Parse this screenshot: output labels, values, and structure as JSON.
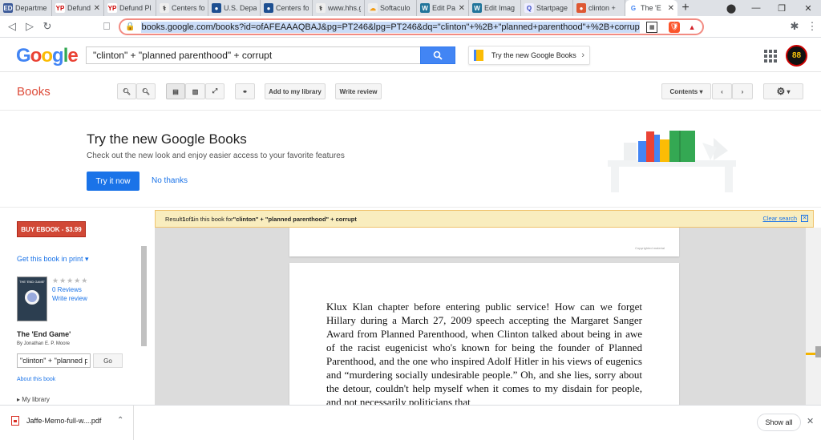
{
  "tabs": [
    {
      "title": "Departme",
      "fav": "ED",
      "favbg": "#3c5a99",
      "favfg": "#fff",
      "close": ""
    },
    {
      "title": "Defund Pl",
      "fav": "YP",
      "favbg": "#fff",
      "favfg": "#c00",
      "close": "✕"
    },
    {
      "title": "Defund Pl",
      "fav": "YP",
      "favbg": "#fff",
      "favfg": "#c00",
      "close": ""
    },
    {
      "title": "Centers fo",
      "fav": "⚕",
      "favbg": "#eee",
      "favfg": "#333",
      "close": ""
    },
    {
      "title": "U.S. Depar",
      "fav": "●",
      "favbg": "#1d4f91",
      "favfg": "#fff",
      "close": ""
    },
    {
      "title": "Centers fo",
      "fav": "●",
      "favbg": "#1d4f91",
      "favfg": "#fff",
      "close": ""
    },
    {
      "title": "www.hhs.g",
      "fav": "⚕",
      "favbg": "#eee",
      "favfg": "#333",
      "close": ""
    },
    {
      "title": "Softaculo",
      "fav": "☁",
      "favbg": "#eee",
      "favfg": "#f39c12",
      "close": ""
    },
    {
      "title": "Edit Pa",
      "fav": "W",
      "favbg": "#21759b",
      "favfg": "#fff",
      "close": "✕"
    },
    {
      "title": "Edit Imag",
      "fav": "W",
      "favbg": "#21759b",
      "favfg": "#fff",
      "close": ""
    },
    {
      "title": "Startpage",
      "fav": "Q",
      "favbg": "#eef",
      "favfg": "#2a3ebf",
      "close": ""
    },
    {
      "title": "clinton +",
      "fav": "●",
      "favbg": "#de5833",
      "favfg": "#fff",
      "close": ""
    },
    {
      "title": "The 'E",
      "fav": "G",
      "favbg": "#fff",
      "favfg": "#4285f4",
      "close": "✕",
      "active": true
    }
  ],
  "toolbar": {
    "url": "books.google.com/books?id=ofAFEAAAQBAJ&pg=PT246&lpg=PT246&dq=\"clinton\"+%2B+\"planned+parenthood\"+%2B+corrupt&source=bl&"
  },
  "google": {
    "logo": [
      "G",
      "o",
      "o",
      "g",
      "l",
      "e"
    ],
    "query": "\"clinton\" + \"planned parenthood\" + corrupt",
    "try_new": "Try the new Google Books",
    "avatar_text": "88"
  },
  "books_bar": {
    "title": "Books",
    "add_library": "Add to my library",
    "write_review": "Write review",
    "contents": "Contents"
  },
  "promo": {
    "heading": "Try the new Google Books",
    "subtext": "Check out the new look and enjoy easier access to your favorite features",
    "try_now": "Try it now",
    "no_thanks": "No thanks",
    "colors": {
      "blue": "#4285f4",
      "red": "#ea4335",
      "yellow": "#fbbc05",
      "green": "#34a853"
    }
  },
  "sidebar": {
    "buy": "BUY EBOOK - $3.99",
    "get_print": "Get this book in print ▾",
    "cover_title": "THE 'END GAME'",
    "stars": "★★★★★",
    "reviews": "0 Reviews",
    "write_review": "Write review",
    "book_title": "The 'End Game'",
    "byline": "By Jonathan E. P. Moore",
    "search_value": "\"clinton\" + \"planned p",
    "go": "Go",
    "about": "About this book",
    "my_library": "▸ My library"
  },
  "result": {
    "prefix": "Result ",
    "n": "1",
    "of": " of ",
    "total": "1",
    "middle": " in this book for ",
    "query": "\"clinton\" + \"planned parenthood\" + corrupt",
    "clear": "Clear search",
    "clear_x": "✕"
  },
  "viewer": {
    "copyright": "Copyrighted material",
    "text": "Klux Klan chapter before entering public service! How can we forget Hillary during a March 27, 2009 speech accepting the Margaret Sanger Award from Planned Parenthood, when Clinton talked about being in awe of the racist eugenicist who's known for being the founder of Planned Parenthood, and the one who inspired Adolf Hitler in his views of eugenics and “murdering socially undesirable people.” Oh, and she lies, sorry about the detour, couldn't help myself when it comes to my disdain for people, and not necessarily politicians that"
  },
  "download": {
    "filename": "Jaffe-Memo-full-w....pdf",
    "show_all": "Show all"
  }
}
